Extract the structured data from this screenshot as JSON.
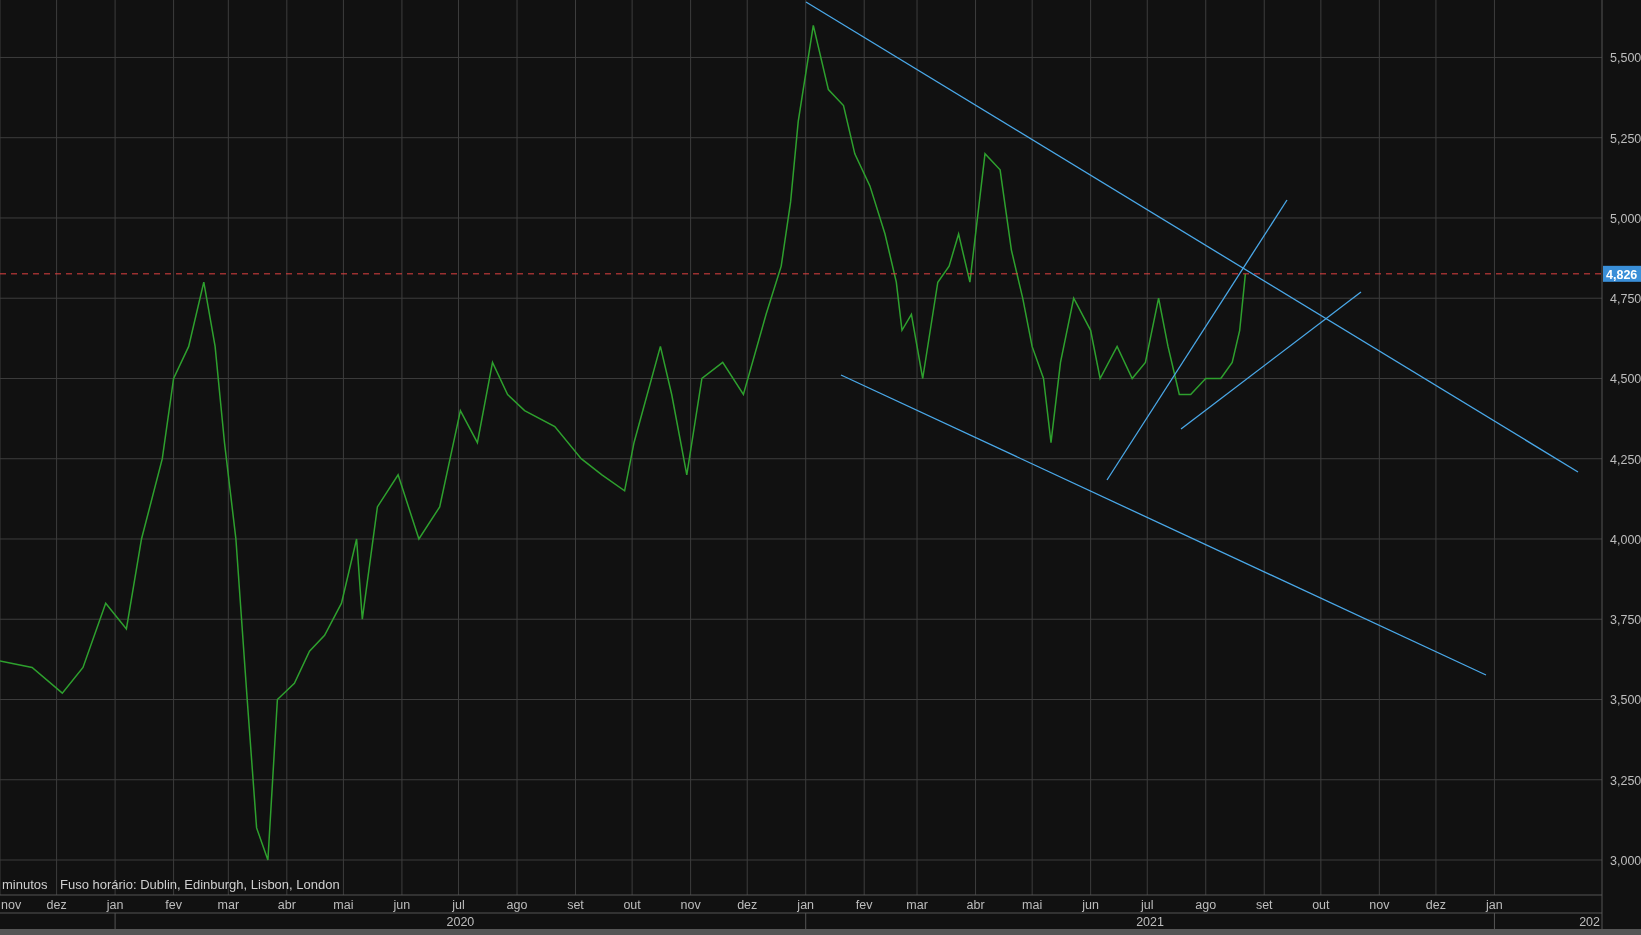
{
  "chart": {
    "chart_data": {
      "type": "line",
      "grid": true,
      "xlim": [
        "2019-11-01",
        "2022-02-27"
      ],
      "ylim": [
        2891,
        5679
      ],
      "yticks": [
        {
          "value": 3000,
          "label": "3,000"
        },
        {
          "value": 3250,
          "label": "3,250"
        },
        {
          "value": 3500,
          "label": "3,500"
        },
        {
          "value": 3750,
          "label": "3,750"
        },
        {
          "value": 4000,
          "label": "4,000"
        },
        {
          "value": 4250,
          "label": "4,250"
        },
        {
          "value": 4500,
          "label": "4,500"
        },
        {
          "value": 4750,
          "label": "4,750"
        },
        {
          "value": 5000,
          "label": "5,000"
        },
        {
          "value": 5250,
          "label": "5,250"
        },
        {
          "value": 5500,
          "label": "5,500"
        }
      ],
      "xticks": [
        {
          "value": "2019-11-01",
          "label": "nov"
        },
        {
          "value": "2019-12-01",
          "label": "dez"
        },
        {
          "value": "2020-01-01",
          "label": "jan"
        },
        {
          "value": "2020-02-01",
          "label": "fev"
        },
        {
          "value": "2020-03-01",
          "label": "mar"
        },
        {
          "value": "2020-04-01",
          "label": "abr"
        },
        {
          "value": "2020-05-01",
          "label": "mai"
        },
        {
          "value": "2020-06-01",
          "label": "jun"
        },
        {
          "value": "2020-07-01",
          "label": "jul"
        },
        {
          "value": "2020-08-01",
          "label": "ago"
        },
        {
          "value": "2020-09-01",
          "label": "set"
        },
        {
          "value": "2020-10-01",
          "label": "out"
        },
        {
          "value": "2020-11-01",
          "label": "nov"
        },
        {
          "value": "2020-12-01",
          "label": "dez"
        },
        {
          "value": "2021-01-01",
          "label": "jan"
        },
        {
          "value": "2021-02-01",
          "label": "fev"
        },
        {
          "value": "2021-03-01",
          "label": "mar"
        },
        {
          "value": "2021-04-01",
          "label": "abr"
        },
        {
          "value": "2021-05-01",
          "label": "mai"
        },
        {
          "value": "2021-06-01",
          "label": "jun"
        },
        {
          "value": "2021-07-01",
          "label": "jul"
        },
        {
          "value": "2021-08-01",
          "label": "ago"
        },
        {
          "value": "2021-09-01",
          "label": "set"
        },
        {
          "value": "2021-10-01",
          "label": "out"
        },
        {
          "value": "2021-11-01",
          "label": "nov"
        },
        {
          "value": "2021-12-01",
          "label": "dez"
        },
        {
          "value": "2022-01-01",
          "label": "jan"
        }
      ],
      "x": [
        "2019-11-01",
        "2019-11-18",
        "2019-12-04",
        "2019-12-15",
        "2019-12-27",
        "2020-01-07",
        "2020-01-15",
        "2020-01-26",
        "2020-02-01",
        "2020-02-09",
        "2020-02-17",
        "2020-02-23",
        "2020-02-28",
        "2020-03-05",
        "2020-03-11",
        "2020-03-16",
        "2020-03-22",
        "2020-03-27",
        "2020-04-05",
        "2020-04-13",
        "2020-04-21",
        "2020-04-30",
        "2020-05-08",
        "2020-05-11",
        "2020-05-19",
        "2020-05-30",
        "2020-06-10",
        "2020-06-21",
        "2020-07-02",
        "2020-07-11",
        "2020-07-19",
        "2020-07-27",
        "2020-08-05",
        "2020-08-21",
        "2020-09-04",
        "2020-09-15",
        "2020-09-27",
        "2020-10-02",
        "2020-10-16",
        "2020-10-22",
        "2020-10-30",
        "2020-11-07",
        "2020-11-18",
        "2020-11-29",
        "2020-12-11",
        "2020-12-19",
        "2020-12-24",
        "2020-12-28",
        "2021-01-05",
        "2021-01-13",
        "2021-01-21",
        "2021-01-27",
        "2021-02-04",
        "2021-02-12",
        "2021-02-18",
        "2021-02-21",
        "2021-02-26",
        "2021-03-04",
        "2021-03-12",
        "2021-03-18",
        "2021-03-23",
        "2021-03-29",
        "2021-04-06",
        "2021-04-14",
        "2021-04-20",
        "2021-04-26",
        "2021-05-01",
        "2021-05-07",
        "2021-05-11",
        "2021-05-16",
        "2021-05-23",
        "2021-06-01",
        "2021-06-06",
        "2021-06-15",
        "2021-06-23",
        "2021-06-30",
        "2021-07-07",
        "2021-07-12",
        "2021-07-18",
        "2021-07-24",
        "2021-08-01",
        "2021-08-09",
        "2021-08-15",
        "2021-08-19",
        "2021-08-22"
      ],
      "series": [
        {
          "color": "#2ea02e",
          "values": [
            3620,
            3600,
            3520,
            3600,
            3800,
            3720,
            4000,
            4250,
            4500,
            4600,
            4800,
            4600,
            4300,
            4000,
            3500,
            3100,
            3000,
            3500,
            3550,
            3650,
            3700,
            3800,
            4000,
            3750,
            4100,
            4200,
            4000,
            4100,
            4400,
            4300,
            4550,
            4450,
            4400,
            4350,
            4250,
            4200,
            4150,
            4300,
            4600,
            4450,
            4200,
            4500,
            4550,
            4450,
            4700,
            4850,
            5050,
            5300,
            5600,
            5400,
            5350,
            5200,
            5100,
            4950,
            4800,
            4650,
            4700,
            4500,
            4800,
            4850,
            4950,
            4800,
            5200,
            5150,
            4900,
            4750,
            4600,
            4500,
            4300,
            4550,
            4750,
            4650,
            4500,
            4600,
            4500,
            4550,
            4750,
            4600,
            4450,
            4450,
            4500,
            4500,
            4550,
            4650,
            4826
          ]
        }
      ],
      "ref_lines": [
        {
          "axis": "y",
          "value": 4826,
          "label": "4,826"
        }
      ]
    },
    "timeframe": "minutos",
    "timezone": "Fuso horário: Dublin, Edinburgh, Lisbon, London",
    "years": [
      {
        "label": "2020"
      },
      {
        "label": "2021"
      },
      {
        "label": "202"
      }
    ]
  }
}
